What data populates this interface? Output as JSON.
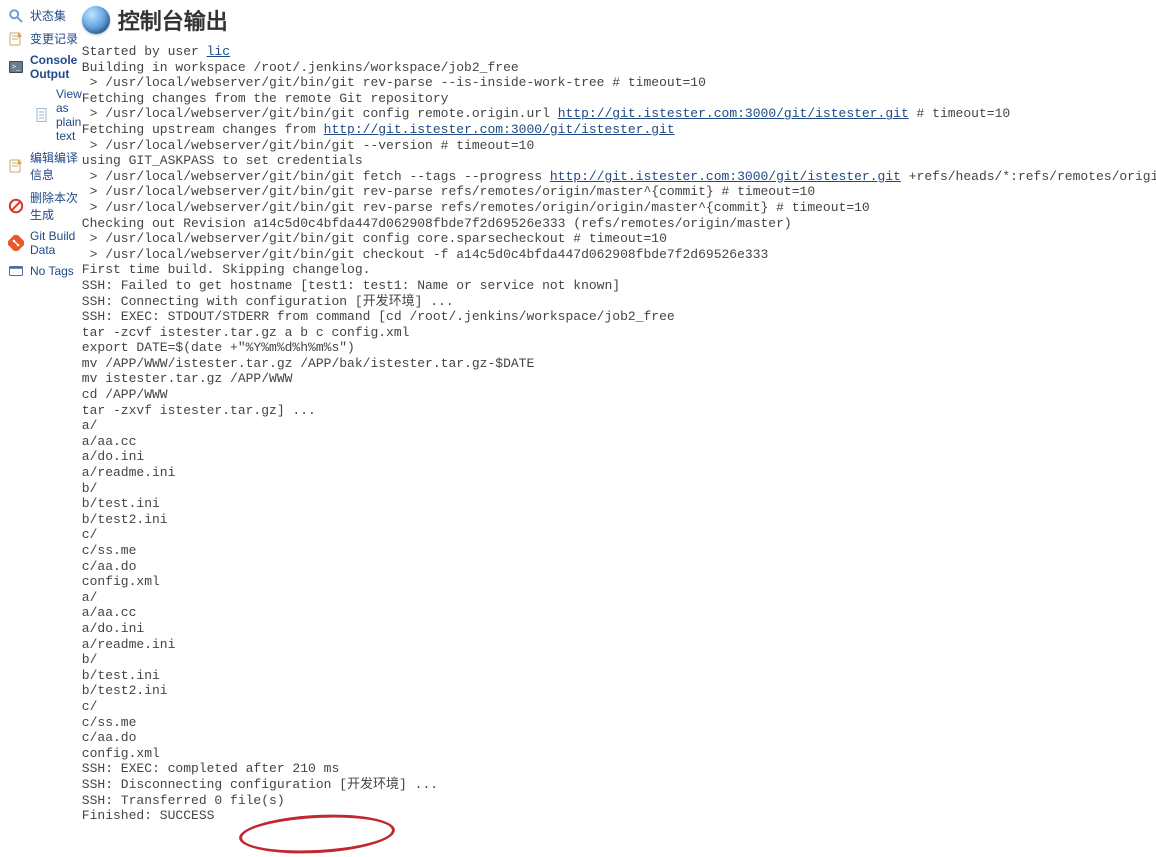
{
  "sidebar": {
    "items": [
      {
        "label": "状态集",
        "icon": "search"
      },
      {
        "label": "变更记录",
        "icon": "notepad"
      },
      {
        "label": "Console Output",
        "icon": "terminal",
        "selected": true
      },
      {
        "label": "View as plain text",
        "icon": "doc",
        "sub": true
      },
      {
        "label": "编辑编译信息",
        "icon": "notepad"
      },
      {
        "label": "删除本次生成",
        "icon": "nosign"
      },
      {
        "label": "Git Build Data",
        "icon": "git"
      },
      {
        "label": "No Tags",
        "icon": "card"
      }
    ]
  },
  "page": {
    "title": "控制台输出"
  },
  "console": {
    "prefix": "Started by user ",
    "user_link": "lic",
    "lines": [
      "Building in workspace /root/.jenkins/workspace/job2_free",
      " > /usr/local/webserver/git/bin/git rev-parse --is-inside-work-tree # timeout=10",
      "Fetching changes from the remote Git repository"
    ],
    "cfg_prefix": " > /usr/local/webserver/git/bin/git config remote.origin.url ",
    "cfg_url": "http://git.istester.com:3000/git/istester.git",
    "cfg_suffix": " # timeout=10",
    "upstream_prefix": "Fetching upstream changes from ",
    "upstream_url": "http://git.istester.com:3000/git/istester.git",
    "lines2": [
      " > /usr/local/webserver/git/bin/git --version # timeout=10",
      "using GIT_ASKPASS to set credentials "
    ],
    "fetch_prefix": " > /usr/local/webserver/git/bin/git fetch --tags --progress ",
    "fetch_url": "http://git.istester.com:3000/git/istester.git",
    "fetch_suffix": " +refs/heads/*:refs/remotes/origin/*",
    "lines3": [
      " > /usr/local/webserver/git/bin/git rev-parse refs/remotes/origin/master^{commit} # timeout=10",
      " > /usr/local/webserver/git/bin/git rev-parse refs/remotes/origin/origin/master^{commit} # timeout=10",
      "Checking out Revision a14c5d0c4bfda447d062908fbde7f2d69526e333 (refs/remotes/origin/master)",
      " > /usr/local/webserver/git/bin/git config core.sparsecheckout # timeout=10",
      " > /usr/local/webserver/git/bin/git checkout -f a14c5d0c4bfda447d062908fbde7f2d69526e333",
      "First time build. Skipping changelog.",
      "SSH: Failed to get hostname [test1: test1: Name or service not known]",
      "SSH: Connecting with configuration [开发环境] ...",
      "SSH: EXEC: STDOUT/STDERR from command [cd /root/.jenkins/workspace/job2_free",
      "tar -zcvf istester.tar.gz a b c config.xml",
      "export DATE=$(date +\"%Y%m%d%h%m%s\")",
      "mv /APP/WWW/istester.tar.gz /APP/bak/istester.tar.gz-$DATE",
      "mv istester.tar.gz /APP/WWW",
      "cd /APP/WWW",
      "tar -zxvf istester.tar.gz] ...",
      "a/",
      "a/aa.cc",
      "a/do.ini",
      "a/readme.ini",
      "b/",
      "b/test.ini",
      "b/test2.ini",
      "c/",
      "c/ss.me",
      "c/aa.do",
      "config.xml",
      "a/",
      "a/aa.cc",
      "a/do.ini",
      "a/readme.ini",
      "b/",
      "b/test.ini",
      "b/test2.ini",
      "c/",
      "c/ss.me",
      "c/aa.do",
      "config.xml",
      "SSH: EXEC: completed after 210 ms",
      "SSH: Disconnecting configuration [开发环境] ...",
      "SSH: Transferred 0 file(s)",
      "Finished: SUCCESS"
    ]
  }
}
